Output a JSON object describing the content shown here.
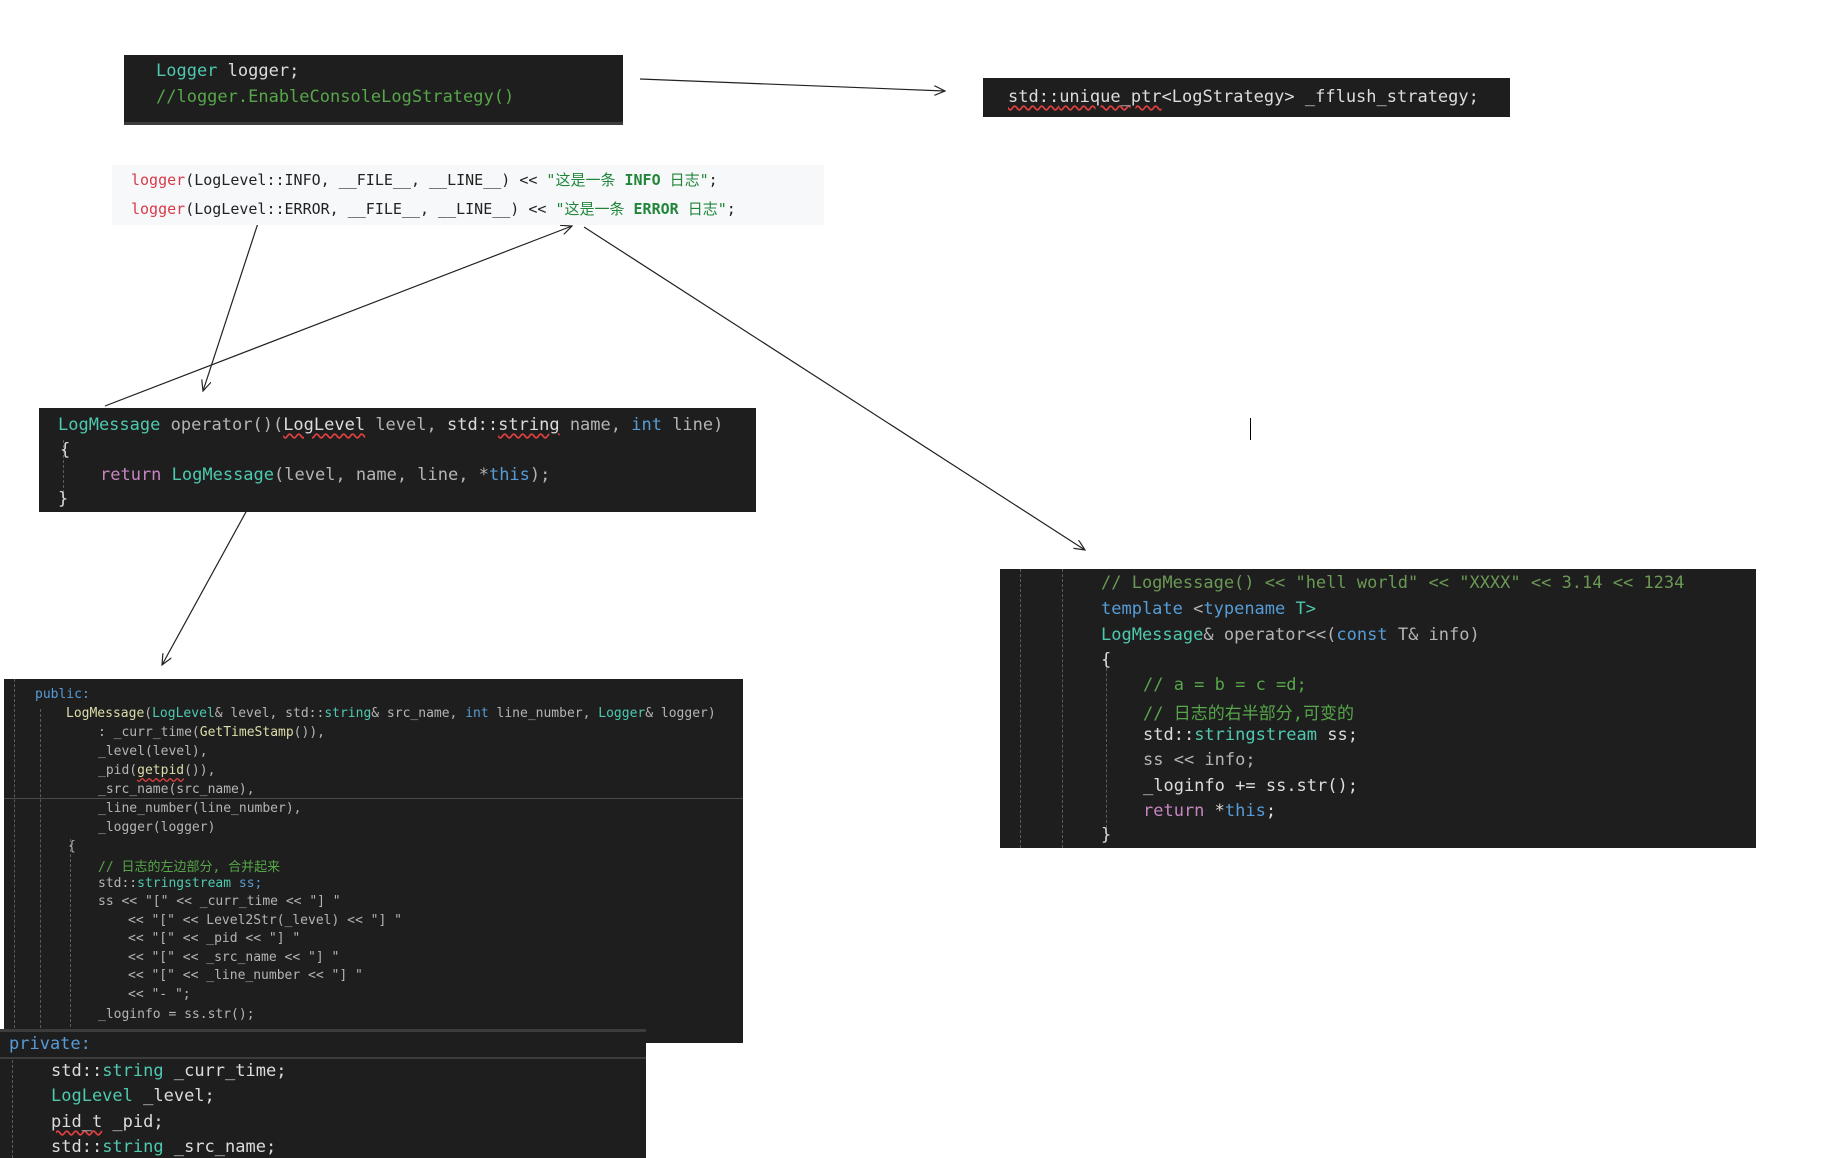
{
  "logger_snippet": {
    "line1": {
      "type": "Logger",
      "var": " logger;"
    },
    "line2": {
      "comment": "//logger.EnableConsoleLogStrategy()"
    }
  },
  "strategy_snippet": {
    "ns": "std::",
    "tpl": "unique_ptr",
    "open": "<",
    "type": "LogStrategy",
    "close": ">",
    "rest": " _fflush_strategy;"
  },
  "call_snippet": {
    "lines": [
      {
        "fn": "logger",
        "args": "(LogLevel::INFO, __FILE__, __LINE__) << ",
        "str_a": "\"这是一条 ",
        "level": "INFO",
        "str_b": " 日志\"",
        "end": ";"
      },
      {
        "fn": "logger",
        "args": "(LogLevel::ERROR, __FILE__, __LINE__) << ",
        "str_a": "\"这是一条 ",
        "level": "ERROR",
        "str_b": " 日志\"",
        "end": ";"
      }
    ]
  },
  "operator_call_snippet": {
    "sig": {
      "ret": "LogMessage",
      "op": " operator()(",
      "t1": "LogLevel",
      "p1": " level, ",
      "ns": "std::",
      "t2": "string",
      "p2": " name, ",
      "t3": "int",
      "p3": " line)"
    },
    "open_brace": "{",
    "body": {
      "kw": "return",
      "fn": " LogMessage",
      "args": "(level, name, line, *",
      "self": "this",
      "end": ");"
    },
    "close_brace": "}"
  },
  "operator_shift_snippet": {
    "comment1": "// LogMessage() << \"hell world\" << \"XXXX\" << 3.14 << 1234",
    "tpl": {
      "kw": "template",
      "open": " <",
      "kw2": "typename",
      "rest": " T>"
    },
    "sig": {
      "ret": "LogMessage",
      "op": "& operator<<(",
      "kw": "const",
      "rest": " T& info)"
    },
    "open_brace": "{",
    "comment2": "// a = b = c =d;",
    "comment3": "// 日志的右半部分,可变的",
    "decl": {
      "ns": "std::",
      "ty": "stringstream",
      "var": " ss;"
    },
    "stream": "ss << info;",
    "append": {
      "lhs": "_loginfo += ",
      "obj": "ss",
      "rest": ".str();"
    },
    "ret": {
      "kw": "return",
      "mid": " *",
      "self": "this",
      "end": ";"
    },
    "close_brace": "}"
  },
  "ctor_snippet": {
    "access": "public:",
    "sig": {
      "name": "LogMessage",
      "p0": "(",
      "t1": "LogLevel",
      "p1": "& level, std::",
      "t2": "string",
      "p2": "& src_name, ",
      "t3": "int",
      "p3": " line_number, ",
      "t4": "Logger",
      "p4": "& logger)"
    },
    "init": [
      {
        "pre": ": _curr_time(",
        "fn": "GetTimeStamp",
        "post": "()),"
      },
      {
        "pre": "_level(level),",
        "fn": "",
        "post": ""
      },
      {
        "pre": "_pid(",
        "fn": "getpid",
        "post": "()),"
      },
      {
        "pre": "_src_name(src_name),",
        "fn": "",
        "post": ""
      },
      {
        "pre": "_line_number(line_number),",
        "fn": "",
        "post": ""
      },
      {
        "pre": "_logger(logger)",
        "fn": "",
        "post": ""
      }
    ],
    "open_brace": "{",
    "comment": "// 日志的左边部分, 合并起来",
    "decl": {
      "ns": "std::",
      "ty": "stringstream",
      "var": " ss;"
    },
    "stream_lines": [
      "ss << \"[\" << _curr_time << \"] \"",
      "<< \"[\" << Level2Str(_level) << \"] \"",
      "<< \"[\" << _pid << \"] \"",
      "<< \"[\" << _src_name << \"] \"",
      "<< \"[\" << _line_number << \"] \"",
      "<< \"- \";"
    ],
    "loginfo": "_loginfo = ss.str();"
  },
  "private_snippet": {
    "access": "private:",
    "members": [
      {
        "ns": "std::",
        "ty": "string",
        "var": " _curr_time;"
      },
      {
        "ns": "",
        "ty": "LogLevel",
        "var": " _level;"
      },
      {
        "ns": "",
        "ty": "pid_t",
        "var": " _pid;"
      },
      {
        "ns": "std::",
        "ty": "string",
        "var": " _src_name;"
      }
    ]
  }
}
